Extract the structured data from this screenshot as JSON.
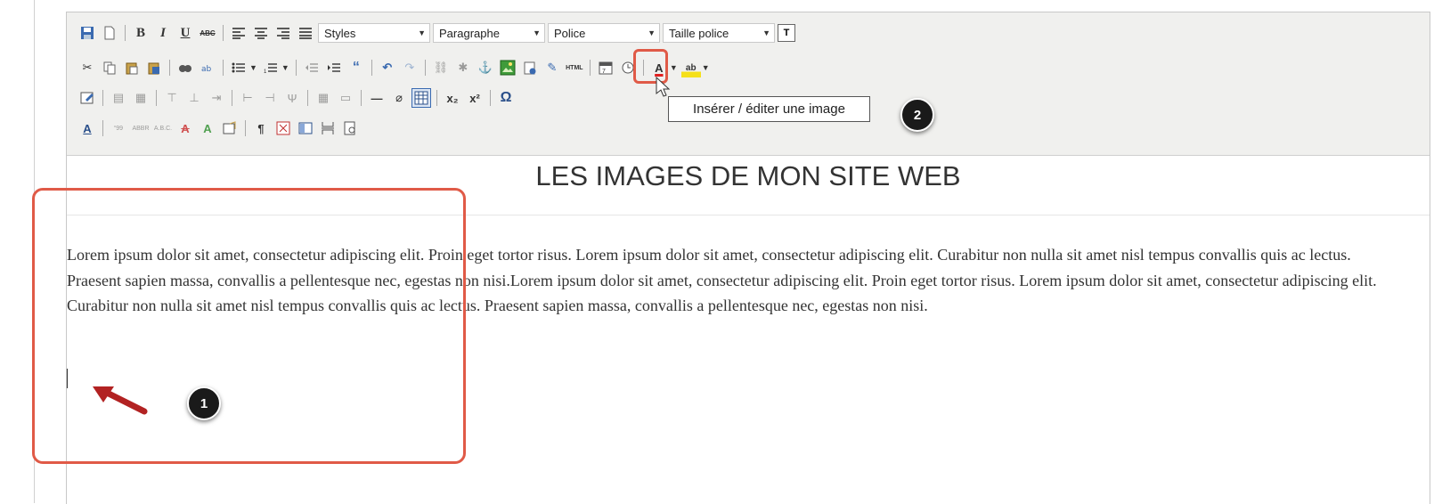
{
  "toolbar": {
    "row1": {
      "styles": "Styles",
      "format": "Paragraphe",
      "font": "Police",
      "size": "Taille police",
      "t_button": "T"
    },
    "row2": {
      "html_label": "HTML"
    }
  },
  "tooltip": "Insérer / éditer une image",
  "badges": {
    "one": "1",
    "two": "2"
  },
  "content": {
    "title": "LES IMAGES DE MON SITE WEB",
    "paragraph": "Lorem ipsum dolor sit amet, consectetur adipiscing elit. Proin eget tortor risus. Lorem ipsum dolor sit amet, consectetur adipiscing elit. Curabitur non nulla sit amet nisl tempus convallis quis ac lectus. Praesent sapien massa, convallis a pellentesque nec, egestas non nisi.Lorem ipsum dolor sit amet, consectetur adipiscing elit. Proin eget tortor risus. Lorem ipsum dolor sit amet, consectetur adipiscing elit. Curabitur non nulla sit amet nisl tempus convallis quis ac lectus. Praesent sapien massa, convallis a pellentesque nec, egestas non nisi."
  },
  "colors": {
    "annotation": "#e05a47",
    "toolbar_bg": "#f0f0ee"
  }
}
